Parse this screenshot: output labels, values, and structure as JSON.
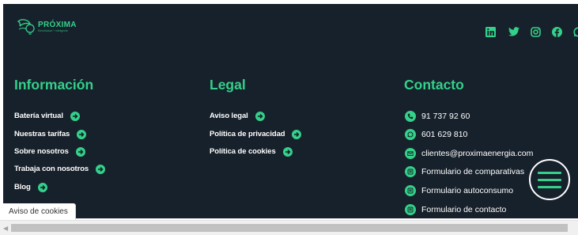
{
  "brand": {
    "name": "PRÓXIMA",
    "tagline": "Electricidad + inteligente",
    "icon": "leaf-bulb-logo"
  },
  "social": [
    {
      "name": "linkedin",
      "icon": "linkedin-icon"
    },
    {
      "name": "twitter",
      "icon": "twitter-icon"
    },
    {
      "name": "instagram",
      "icon": "instagram-icon"
    },
    {
      "name": "facebook",
      "icon": "facebook-icon"
    },
    {
      "name": "whatsapp",
      "icon": "whatsapp-icon"
    }
  ],
  "columns": {
    "informacion": {
      "title": "Información",
      "links": [
        "Batería virtual",
        "Nuestras tarifas",
        "Sobre nosotros",
        "Trabaja con nosotros",
        "Blog"
      ]
    },
    "legal": {
      "title": "Legal",
      "links": [
        "Aviso legal",
        "Política de privacidad",
        "Política de cookies"
      ]
    },
    "contacto": {
      "title": "Contacto",
      "items": [
        {
          "label": "91 737 92 60",
          "icon": "phone-icon"
        },
        {
          "label": "601 629 810",
          "icon": "whatsapp-icon"
        },
        {
          "label": "clientes@proximaenergia.com",
          "icon": "email-icon"
        },
        {
          "label": "Formulario de comparativas",
          "icon": "form-icon"
        },
        {
          "label": "Formulario autoconsumo",
          "icon": "form-icon"
        },
        {
          "label": "Formulario de contacto",
          "icon": "form-icon"
        }
      ]
    }
  },
  "cookie_tab": {
    "label": "Aviso de cookies"
  },
  "menu_button": {
    "icon": "hamburger-menu-icon"
  },
  "colors": {
    "background": "#17212b",
    "accent": "#33d18a",
    "text": "#ffffff"
  }
}
